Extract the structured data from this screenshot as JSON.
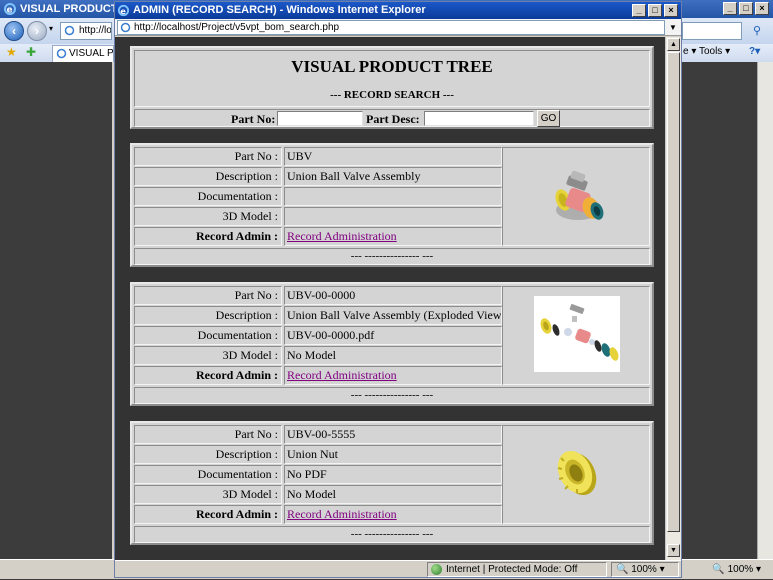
{
  "background_window": {
    "title": "VISUAL PRODUCT TR",
    "url": "http://loc",
    "tab_label": "VISUAL PRO",
    "tools_label": "e ▾  Tools ▾",
    "status_zoom": "100%"
  },
  "window": {
    "title": "ADMIN (RECORD SEARCH) - Windows Internet Explorer",
    "url": "http://localhost/Project/v5vpt_bom_search.php",
    "status_protected": "Internet | Protected Mode: Off",
    "status_zoom": "100%"
  },
  "page": {
    "title": "VISUAL PRODUCT TREE",
    "subtitle": "--- RECORD SEARCH ---",
    "search": {
      "part_no_label": "Part No:",
      "part_no_value": "",
      "part_desc_label": "Part Desc:",
      "part_desc_value": "",
      "go_label": "GO"
    },
    "labels": {
      "part_no": "Part No :",
      "description": "Description :",
      "documentation": "Documentation :",
      "model": "3D Model :",
      "admin": "Record Admin :"
    },
    "footer_text": "--- --------------- ---",
    "records": [
      {
        "part_no": "UBV",
        "description": "Union Ball Valve Assembly",
        "documentation": "",
        "model": "",
        "admin_link": "Record Administration",
        "image": "ball-valve-assembly"
      },
      {
        "part_no": "UBV-00-0000",
        "description": "Union Ball Valve Assembly (Exploded View)",
        "documentation": "UBV-00-0000.pdf",
        "model": "No Model",
        "admin_link": "Record Administration",
        "image": "exploded-valve"
      },
      {
        "part_no": "UBV-00-5555",
        "description": "Union Nut",
        "documentation": "No PDF",
        "model": "No Model",
        "admin_link": "Record Administration",
        "image": "union-nut"
      }
    ]
  }
}
